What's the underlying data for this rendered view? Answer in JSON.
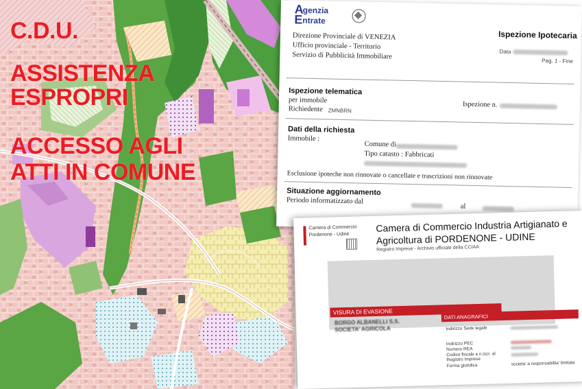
{
  "headlines": {
    "cdu": "C.D.U.",
    "assistenza": "ASSISTENZA",
    "espropri": "ESPROPRI",
    "accesso": "ACCESSO AGLI",
    "atti": "ATTI IN COMUNE"
  },
  "colors": {
    "headline": "#ec1c24",
    "agenzia_blue": "#2b3b8f",
    "cciaa_red": "#c41e26"
  },
  "ispezione_doc": {
    "logo_top": "genzia",
    "logo_bottom": "ntrate",
    "logo_letter_a": "A",
    "logo_letter_e": "E",
    "office": [
      "Direzione Provinciale di VENEZIA",
      "Ufficio provinciale - Territorio",
      "Servizio di Pubblicità Immobiliare"
    ],
    "doc_title": "Ispezione Ipotecaria",
    "date_label": "Data",
    "page": "Pag. 1 - Fine",
    "section1_title": "Ispezione telematica",
    "per_immobile": "per immobile",
    "richiedente_label": "Richiedente",
    "richiedente_value": "ZMNBRN",
    "ispezione_n_label": "Ispezione n.",
    "section2_title": "Dati della richiesta",
    "immobile_label": "Immobile :",
    "comune_label": "Comune di",
    "tipo_catasto": "Tipo catasto : Fabbricati",
    "esclusione": "Esclusione ipoteche non rinnovate o cancellate e trascrizioni non rinnovate",
    "section3_title": "Situazione aggiornamento",
    "periodo": "Periodo informatizzato dal",
    "al": "al"
  },
  "visura_doc": {
    "logo_name": "Camera di Commercio",
    "logo_place": "Pordenone - Udine",
    "title_line1": "Camera di Commercio Industria Artigianato e",
    "title_line2": "Agricoltura di PORDENONE - UDINE",
    "subtitle": "Registro Imprese - Archivio ufficiale della CCIAA",
    "visura_bar": "VISURA DI EVASIONE",
    "company_line1": "BORGO ALBANELLI S.S.",
    "company_line2": "SOCIETA' AGRICOLA",
    "dati_bar": "DATI ANAGRAFICI",
    "fields": [
      "Indirizzo Sede legale",
      "Indirizzo PEC",
      "Numero REA",
      "Codice fiscale e n.iscr. al Registro Imprese",
      "Forma giuridica"
    ],
    "forma_value": "societa' a responsabilita' limitata"
  }
}
